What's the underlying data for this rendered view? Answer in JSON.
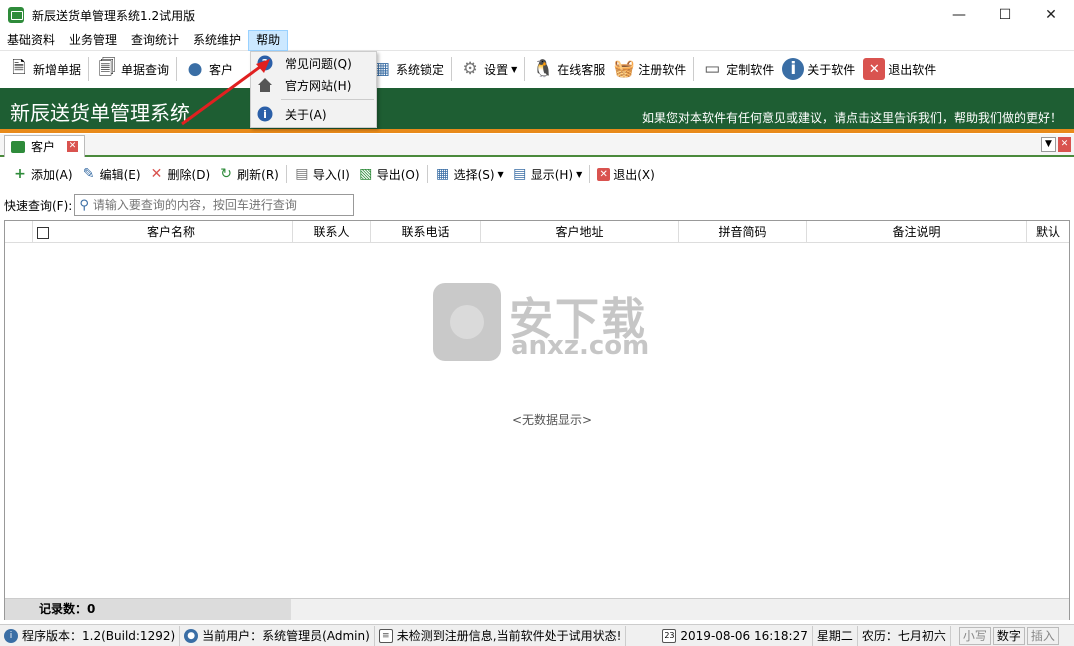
{
  "window": {
    "title": "新辰送货单管理系统1.2试用版",
    "minimize": "—",
    "maximize": "☐",
    "close": "✕"
  },
  "menu": [
    "基础资料",
    "业务管理",
    "查询统计",
    "系统维护",
    "帮助"
  ],
  "toolbar": [
    {
      "label": "新增单据",
      "icon": "new-doc-icon"
    },
    {
      "label": "单据查询",
      "icon": "doc-search-icon"
    },
    {
      "label": "客户",
      "icon": "customers-icon"
    },
    {
      "label": "系统锁定",
      "icon": "lock-icon"
    },
    {
      "label": "设置",
      "icon": "gear-icon"
    },
    {
      "label": "在线客服",
      "icon": "qq-icon"
    },
    {
      "label": "注册软件",
      "icon": "basket-icon"
    },
    {
      "label": "定制软件",
      "icon": "window-icon"
    },
    {
      "label": "关于软件",
      "icon": "info-icon"
    },
    {
      "label": "退出软件",
      "icon": "exit-icon"
    }
  ],
  "banner": {
    "title": "新辰送货单管理系统",
    "message": "如果您对本软件有任何意见或建议，请点击这里告诉我们，帮助我们做的更好！"
  },
  "help_menu": {
    "items": [
      {
        "label": "常见问题(Q)",
        "icon": "question-icon"
      },
      {
        "label": "官方网站(H)",
        "icon": "home-icon"
      },
      {
        "label": "关于(A)",
        "icon": "info-icon"
      }
    ]
  },
  "tab": {
    "label": "客户"
  },
  "actions": [
    {
      "label": "添加(A)",
      "icon": "plus-icon"
    },
    {
      "label": "编辑(E)",
      "icon": "edit-icon"
    },
    {
      "label": "删除(D)",
      "icon": "delete-icon"
    },
    {
      "label": "刷新(R)",
      "icon": "refresh-icon"
    },
    {
      "label": "导入(I)",
      "icon": "import-icon"
    },
    {
      "label": "导出(O)",
      "icon": "export-icon"
    },
    {
      "label": "选择(S)",
      "icon": "select-icon"
    },
    {
      "label": "显示(H)",
      "icon": "display-icon"
    },
    {
      "label": "退出(X)",
      "icon": "exit-icon"
    }
  ],
  "search": {
    "label": "快速查询(F):",
    "placeholder": "请输入要查询的内容，按回车进行查询"
  },
  "grid": {
    "columns": [
      "客户名称",
      "联系人",
      "联系电话",
      "客户地址",
      "拼音简码",
      "备注说明",
      "默认"
    ],
    "empty_text": "<无数据显示>",
    "record_count": "记录数：0"
  },
  "watermark": {
    "text": "安下载",
    "sub": "anxz.com"
  },
  "status": {
    "version": "程序版本：1.2(Build:1292)",
    "user": "当前用户：系统管理员(Admin)",
    "register": "未检测到注册信息,当前软件处于试用状态!",
    "datetime": "2019-08-06 16:18:27",
    "weekday": "星期二",
    "lunar": "农历：七月初六",
    "date_badge": "23",
    "keys": [
      "小写",
      "数字",
      "插入"
    ]
  },
  "colors": {
    "banner": "#1e5e33",
    "accent_line": "#e88a1a",
    "arrow": "#e02020"
  }
}
